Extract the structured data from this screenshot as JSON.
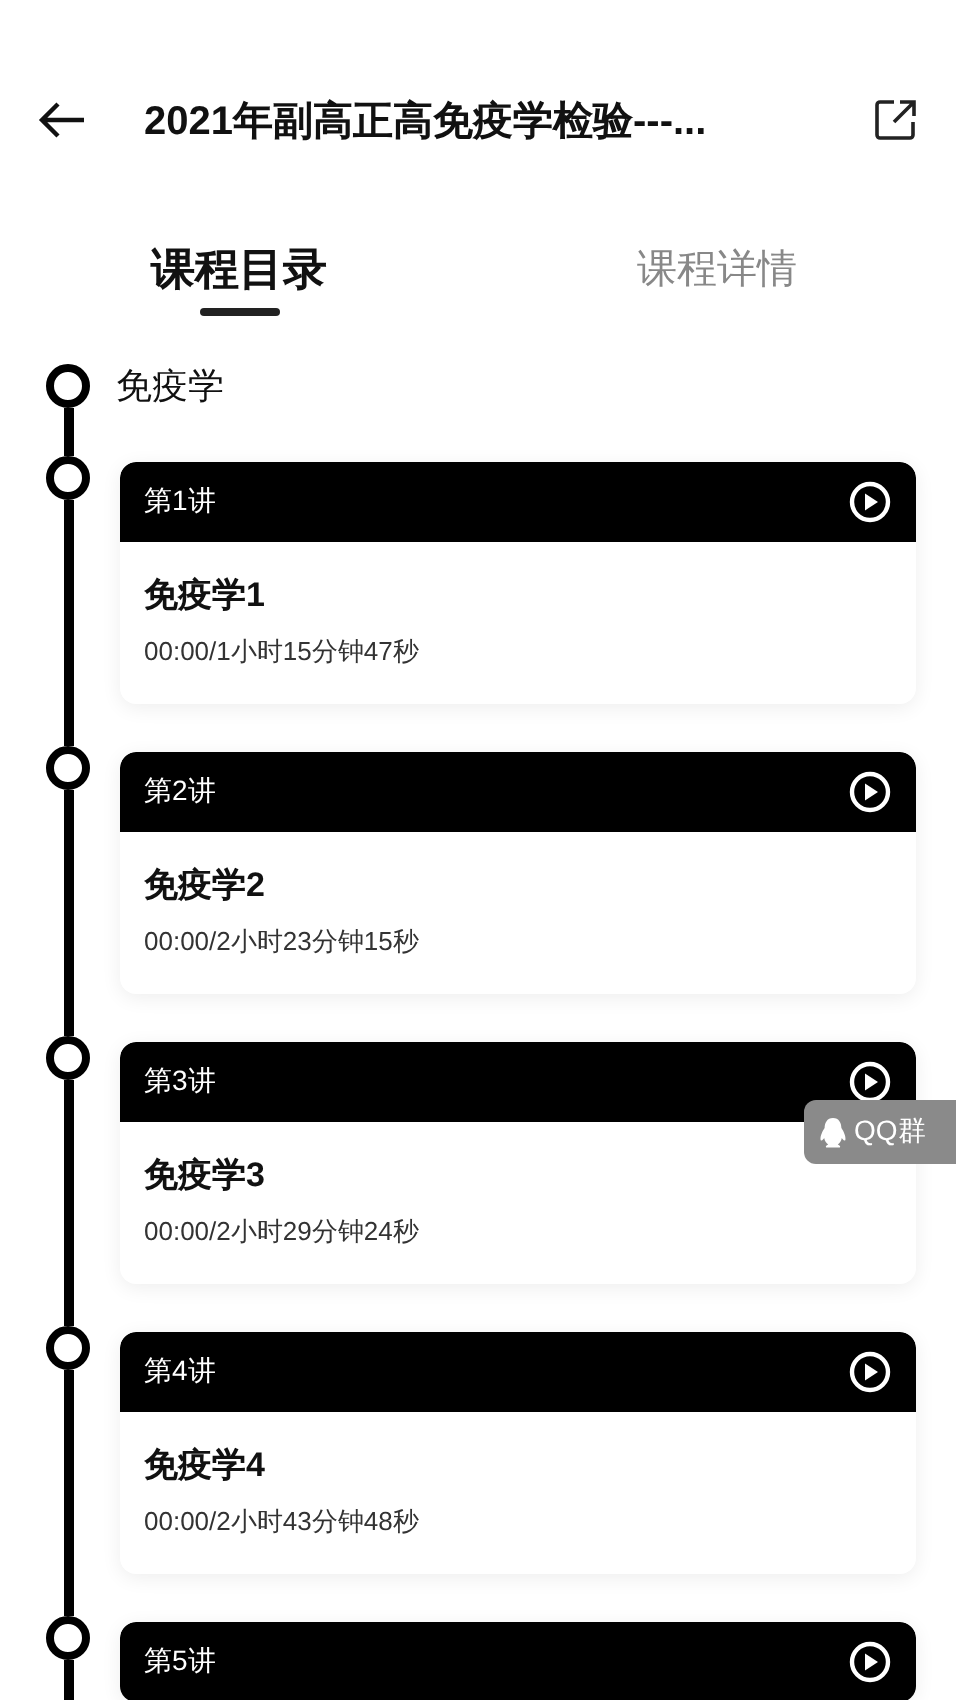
{
  "header": {
    "title": "2021年副高正高免疫学检验---..."
  },
  "tabs": [
    {
      "label": "课程目录",
      "selected": true
    },
    {
      "label": "课程详情",
      "selected": false
    }
  ],
  "section": {
    "title": "免疫学"
  },
  "lessons": [
    {
      "label": "第1讲",
      "title": "免疫学1",
      "duration": "00:00/1小时15分钟47秒"
    },
    {
      "label": "第2讲",
      "title": "免疫学2",
      "duration": "00:00/2小时23分钟15秒"
    },
    {
      "label": "第3讲",
      "title": "免疫学3",
      "duration": "00:00/2小时29分钟24秒"
    },
    {
      "label": "第4讲",
      "title": "免疫学4",
      "duration": "00:00/2小时43分钟48秒"
    },
    {
      "label": "第5讲"
    }
  ],
  "floating_badge": {
    "label": "QQ群"
  }
}
